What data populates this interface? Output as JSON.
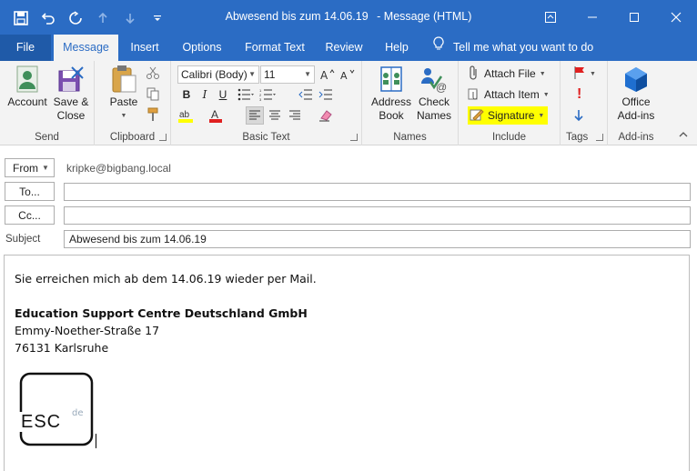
{
  "window": {
    "title": "Abwesend bis zum 14.06.19",
    "title_suffix": "-  Message (HTML)",
    "qat_icons": [
      "save-icon",
      "undo-icon",
      "redo-icon",
      "up-arrow-icon",
      "down-arrow-icon",
      "customize-qat-icon"
    ],
    "controls": [
      "ribbon-display-icon",
      "minimize-icon",
      "maximize-icon",
      "close-icon"
    ]
  },
  "tabs": [
    {
      "label": "File"
    },
    {
      "label": "Message"
    },
    {
      "label": "Insert"
    },
    {
      "label": "Options"
    },
    {
      "label": "Format Text"
    },
    {
      "label": "Review"
    },
    {
      "label": "Help"
    }
  ],
  "tell_me": "Tell me what you want to do",
  "ribbon": {
    "send": {
      "label": "Send",
      "account": "Account",
      "save_close_1": "Save &",
      "save_close_2": "Close"
    },
    "clipboard": {
      "label": "Clipboard",
      "paste": "Paste"
    },
    "basic_text": {
      "label": "Basic Text",
      "font": "Calibri (Body)",
      "size": "11"
    },
    "names": {
      "label": "Names",
      "address_1": "Address",
      "address_2": "Book",
      "check_1": "Check",
      "check_2": "Names"
    },
    "include": {
      "label": "Include",
      "attach_file": "Attach File",
      "attach_item": "Attach Item",
      "signature": "Signature"
    },
    "tags": {
      "label": "Tags"
    },
    "addins": {
      "label": "Add-ins",
      "office_1": "Office",
      "office_2": "Add-ins"
    }
  },
  "header": {
    "from_label": "From",
    "from_value": "kripke@bigbang.local",
    "to_label": "To...",
    "to_value": "",
    "cc_label": "Cc...",
    "cc_value": "",
    "subject_label": "Subject",
    "subject_value": "Abwesend bis zum 14.06.19"
  },
  "body": {
    "line1": "Sie erreichen mich ab dem 14.06.19 wieder per Mail.",
    "company": "Education Support Centre Deutschland GmbH",
    "street": "Emmy-Noether-Straße 17",
    "city": "76131 Karlsruhe",
    "logo_text": "ESC",
    "logo_sup": "de"
  },
  "colors": {
    "accent": "#2b6cc4",
    "signature_highlight": "#ffff00"
  }
}
